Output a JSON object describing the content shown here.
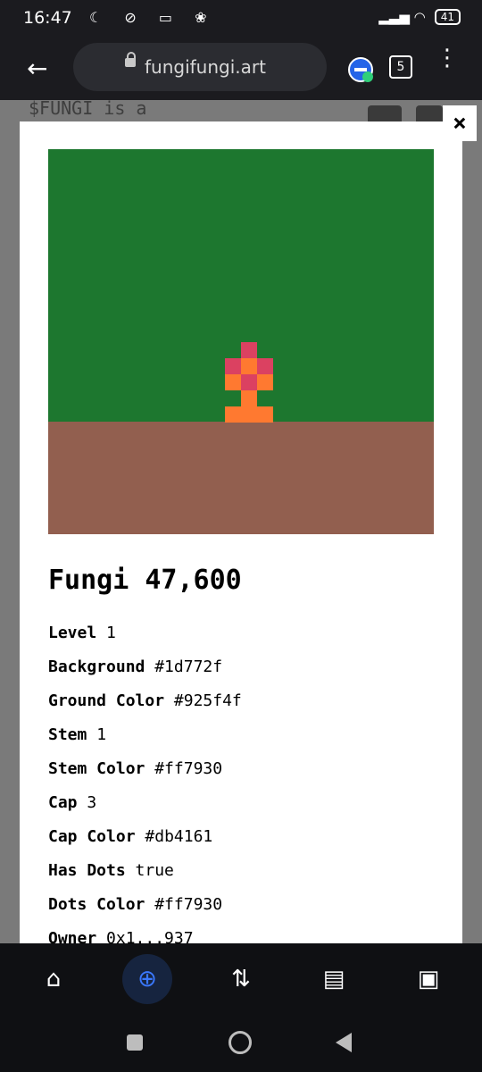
{
  "status_bar": {
    "time": "16:47",
    "left_icons": "☾ ⊘ ▭ ❀",
    "right_icons": "▂▃▅ ◠",
    "battery": "41"
  },
  "browser": {
    "url": "fungifungi.art",
    "tab_count": "5",
    "menu": "⋮",
    "back": "←"
  },
  "background_page": {
    "text": "$FUNGI is a\n  i    f ll"
  },
  "close_label": "×",
  "art": {
    "background_color": "#1d772f",
    "ground_color": "#925f4f",
    "stem_color": "#ff7930",
    "cap_color": "#db4161",
    "dots_color": "#ff7930"
  },
  "title": "Fungi 47,600",
  "attributes": [
    {
      "key": "Level",
      "value": "1"
    },
    {
      "key": "Background",
      "value": "#1d772f"
    },
    {
      "key": "Ground Color",
      "value": "#925f4f"
    },
    {
      "key": "Stem",
      "value": "1"
    },
    {
      "key": "Stem Color",
      "value": "#ff7930"
    },
    {
      "key": "Cap",
      "value": "3"
    },
    {
      "key": "Cap Color",
      "value": "#db4161"
    },
    {
      "key": "Has Dots",
      "value": "true"
    },
    {
      "key": "Dots Color",
      "value": "#ff7930"
    },
    {
      "key": "Owner",
      "value": "0x1...937"
    }
  ],
  "bottom_nav": [
    {
      "name": "home",
      "icon": "⌂"
    },
    {
      "name": "explore",
      "icon": "⊕"
    },
    {
      "name": "transfer",
      "icon": "⇅"
    },
    {
      "name": "document",
      "icon": "▤"
    },
    {
      "name": "wallet",
      "icon": "▣"
    }
  ]
}
